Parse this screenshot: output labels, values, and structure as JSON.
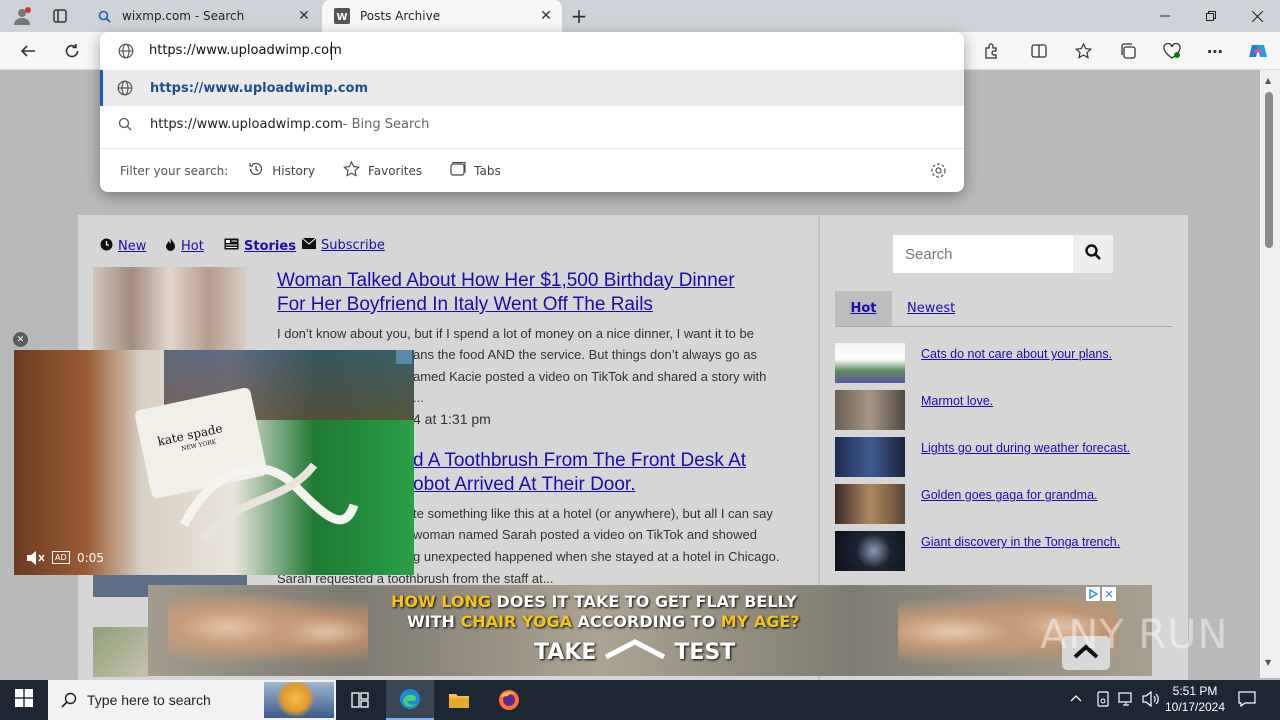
{
  "browser": {
    "tabs": [
      {
        "label": "wixmp.com - Search",
        "icon": "search-icon"
      },
      {
        "label": "Posts Archive",
        "icon": "site-logo-icon"
      }
    ],
    "new_tab_label": "+",
    "address": {
      "value": "https://www.uploadwimp.com"
    },
    "suggestions": [
      {
        "text": "https://www.uploadwimp.com",
        "suffix": "",
        "icon": "globe-icon"
      },
      {
        "text": "https://www.uploadwimp.com",
        "suffix": " - Bing Search",
        "icon": "search-icon"
      }
    ],
    "filter": {
      "label": "Filter your search:",
      "options": [
        "History",
        "Favorites",
        "Tabs"
      ]
    }
  },
  "site": {
    "nav": {
      "new": "New",
      "hot": "Hot",
      "stories": "Stories",
      "subscribe": "Subscribe"
    },
    "articles": [
      {
        "title_line1": "Woman Talked About How Her $1,500 Birthday Dinner",
        "title_line2": "For Her Boyfriend In Italy Went Off The Rails",
        "body_line1": "I don’t know about you, but if I spend a lot of money on a nice dinner, I want it to be",
        "body_line2": "ans the food AND the service. But things don’t always go as",
        "body_line3": "amed Kacie posted a video on TikTok and shared a story with",
        "body_line4": "...",
        "date": "4 at 1:31 pm"
      },
      {
        "title_line1": "d A Toothbrush From The Front Desk At",
        "title_line2": "obot Arrived At Their Door.",
        "body_line1": "te something like this at a hotel (or anywhere), but all I can say",
        "body_line2": "woman named Sarah posted a video on TikTok and showed",
        "body_line3": "g unexpected happened when she stayed at a hotel in Chicago.",
        "body_line4": "Sarah requested a toothbrush from the staff at..."
      }
    ],
    "sidebar": {
      "search_placeholder": "Search",
      "tabs": [
        "Hot",
        "Newest"
      ],
      "items": [
        "Cats do not care about your plans.",
        "Marmot love.",
        "Lights go out during weather forecast.",
        "Golden goes gaga for grandma.",
        "Giant discovery in the Tonga trench."
      ]
    }
  },
  "video": {
    "time": "0:05",
    "ad_badge": "AD",
    "sock_brand": "kate spade",
    "sock_sub": "NEW YORK"
  },
  "ad": {
    "line1_parts": [
      "HOW LONG",
      " DOES IT TAKE TO GET FLAT BELLY"
    ],
    "line2_parts": [
      "WITH ",
      "CHAIR YOGA",
      " ACCORDING TO ",
      "MY AGE?"
    ],
    "cta_left": "TAKE",
    "cta_right": "TEST"
  },
  "watermark": "ANY RUN",
  "taskbar": {
    "search_placeholder": "Type here to search",
    "time": "5:51 PM",
    "date": "10/17/2024"
  },
  "colors": {
    "link": "#1a0dab",
    "ad_yellow": "#f5c518",
    "taskbar": "#1c2733"
  }
}
